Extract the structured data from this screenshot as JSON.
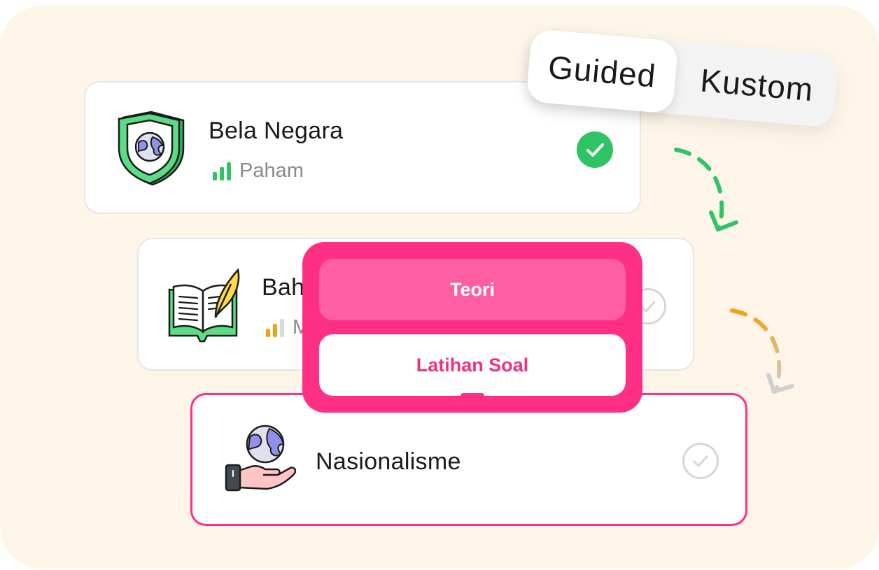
{
  "mode_toggle": {
    "options": [
      "Guided",
      "Kustom"
    ],
    "selected": "Guided"
  },
  "topics": [
    {
      "title": "Bela Negara",
      "level": "Paham",
      "level_bars_filled": 3,
      "level_color": "#2fc463",
      "completed": true,
      "icon": "shield-globe-icon"
    },
    {
      "title": "Bahasa",
      "level": "M",
      "level_bars_filled": 2,
      "level_color": "#f5a012",
      "completed": false,
      "icon": "book-quill-icon"
    },
    {
      "title": "Nasionalisme",
      "level": "",
      "completed": false,
      "selected": true,
      "icon": "hand-globe-icon"
    }
  ],
  "popup": {
    "options": [
      "Teori",
      "Latihan Soal"
    ],
    "active": "Teori"
  },
  "colors": {
    "background": "#fdf5e8",
    "accent": "#ff2f86",
    "success": "#2fc463",
    "warning": "#f5a012"
  }
}
